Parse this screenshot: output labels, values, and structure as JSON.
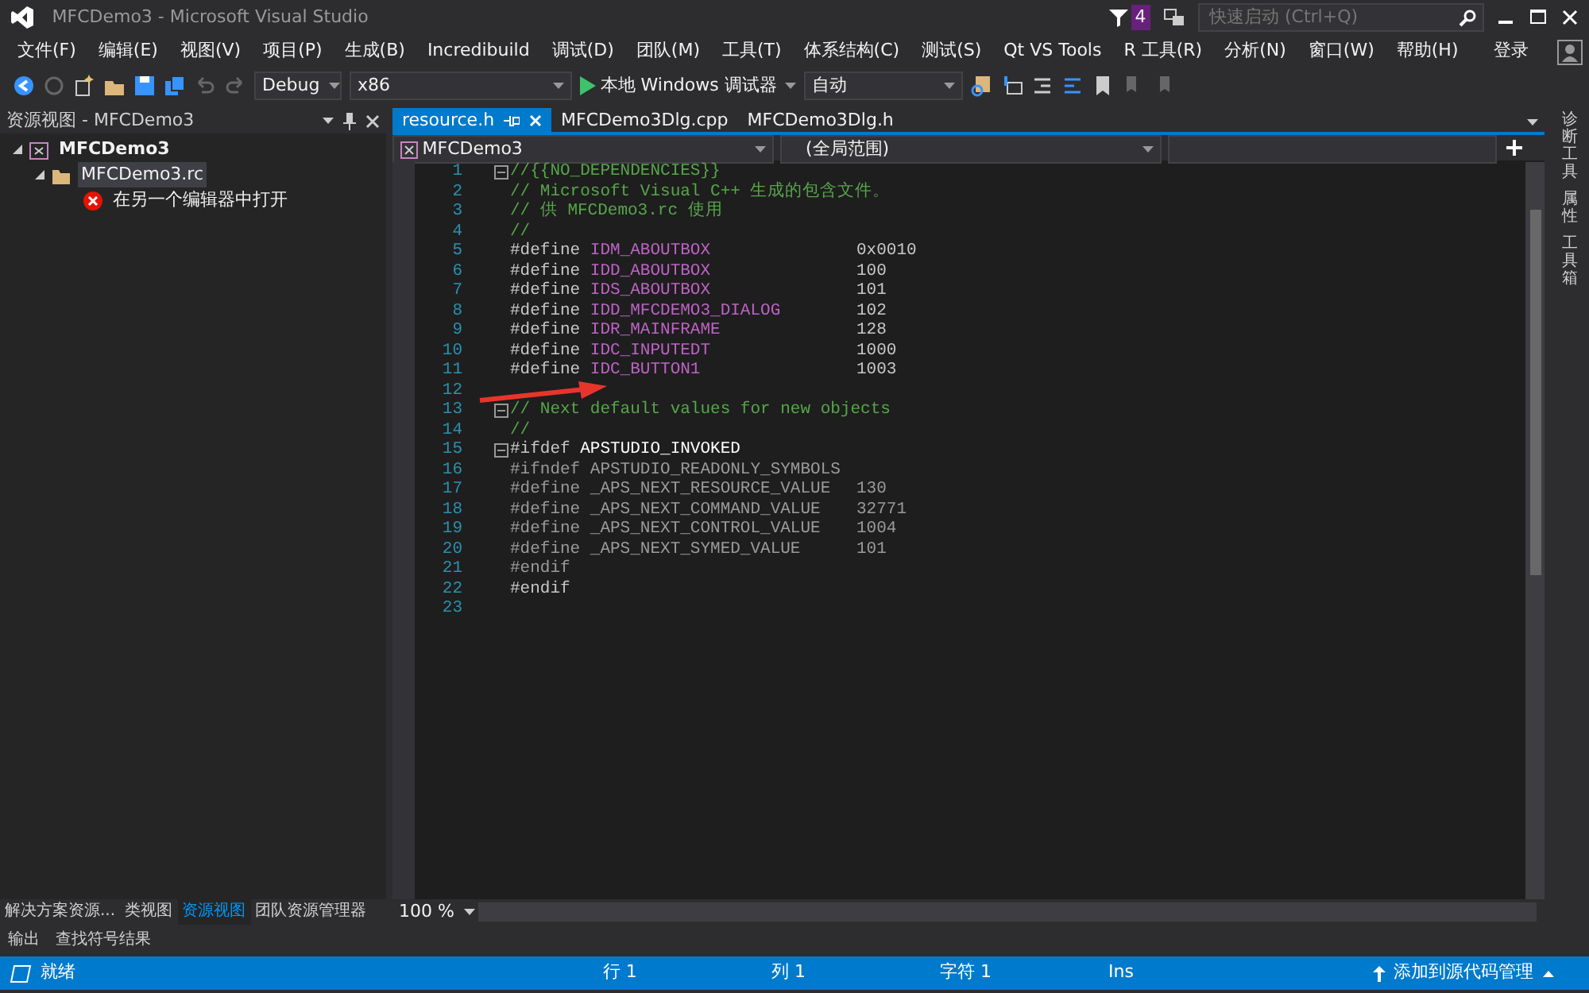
{
  "window": {
    "title": "MFCDemo3 - Microsoft Visual Studio",
    "notification_count": "4",
    "quick_launch": {
      "placeholder": "快速启动 (Ctrl+Q)"
    }
  },
  "menu": [
    "文件(F)",
    "编辑(E)",
    "视图(V)",
    "项目(P)",
    "生成(B)",
    "Incredibuild",
    "调试(D)",
    "团队(M)",
    "工具(T)",
    "体系结构(C)",
    "测试(S)",
    "Qt VS Tools",
    "R 工具(R)",
    "分析(N)",
    "窗口(W)",
    "帮助(H)"
  ],
  "sign_in": "登录",
  "toolbar": {
    "configuration": "Debug",
    "platform": "x86",
    "run": "本地 Windows 调试器",
    "run_target": "自动"
  },
  "resource_view": {
    "title": "资源视图 - MFCDemo3",
    "tree": [
      {
        "label": "MFCDemo3",
        "kind": "project",
        "expanded": true,
        "selected": false,
        "children": [
          {
            "label": "MFCDemo3.rc",
            "kind": "folder",
            "expanded": true,
            "selected": true,
            "children": [
              {
                "label": "在另一个编辑器中打开",
                "kind": "error",
                "selected": false
              }
            ]
          }
        ]
      }
    ],
    "tabs": [
      {
        "label": "解决方案资源...",
        "selected": false
      },
      {
        "label": "类视图",
        "selected": false
      },
      {
        "label": "资源视图",
        "selected": true
      },
      {
        "label": "团队资源管理器",
        "selected": false
      }
    ]
  },
  "editor": {
    "tabs": [
      {
        "label": "resource.h",
        "selected": true
      },
      {
        "label": "MFCDemo3Dlg.cpp",
        "selected": false
      },
      {
        "label": "MFCDemo3Dlg.h",
        "selected": false
      }
    ],
    "scope": "MFCDemo3",
    "member_scope": "(全局范围)",
    "zoom": "100 %",
    "lines": [
      {
        "number": "1",
        "fold": true,
        "tokens": [
          {
            "text": "//{{NO_DEPENDENCIES}}",
            "kind": "comment"
          }
        ]
      },
      {
        "number": "2",
        "fold": false,
        "tokens": [
          {
            "text": "// Microsoft Visual C++ 生成的包含文件。",
            "kind": "comment"
          }
        ]
      },
      {
        "number": "3",
        "fold": false,
        "tokens": [
          {
            "text": "// 供 MFCDemo3.rc 使用",
            "kind": "comment"
          }
        ]
      },
      {
        "number": "4",
        "fold": false,
        "tokens": [
          {
            "text": "//",
            "kind": "comment"
          }
        ]
      },
      {
        "number": "5",
        "fold": false,
        "tokens": [
          {
            "text": "#define",
            "kind": "plain"
          },
          {
            "text": "IDM_ABOUTBOX",
            "kind": "macro"
          }
        ],
        "value": {
          "text": "0x0010",
          "kind": "plain"
        }
      },
      {
        "number": "6",
        "fold": false,
        "tokens": [
          {
            "text": "#define",
            "kind": "plain"
          },
          {
            "text": "IDD_ABOUTBOX",
            "kind": "macro"
          }
        ],
        "value": {
          "text": "100",
          "kind": "plain"
        }
      },
      {
        "number": "7",
        "fold": false,
        "tokens": [
          {
            "text": "#define",
            "kind": "plain"
          },
          {
            "text": "IDS_ABOUTBOX",
            "kind": "macro"
          }
        ],
        "value": {
          "text": "101",
          "kind": "plain"
        }
      },
      {
        "number": "8",
        "fold": false,
        "tokens": [
          {
            "text": "#define",
            "kind": "plain"
          },
          {
            "text": "IDD_MFCDEMO3_DIALOG",
            "kind": "macro"
          }
        ],
        "value": {
          "text": "102",
          "kind": "plain"
        }
      },
      {
        "number": "9",
        "fold": false,
        "tokens": [
          {
            "text": "#define",
            "kind": "plain"
          },
          {
            "text": "IDR_MAINFRAME",
            "kind": "macro"
          }
        ],
        "value": {
          "text": "128",
          "kind": "plain"
        }
      },
      {
        "number": "10",
        "fold": false,
        "tokens": [
          {
            "text": "#define",
            "kind": "plain"
          },
          {
            "text": "IDC_INPUTEDT",
            "kind": "macro"
          }
        ],
        "value": {
          "text": "1000",
          "kind": "plain"
        }
      },
      {
        "number": "11",
        "fold": false,
        "tokens": [
          {
            "text": "#define",
            "kind": "plain"
          },
          {
            "text": "IDC_BUTTON1",
            "kind": "macro"
          }
        ],
        "value": {
          "text": "1003",
          "kind": "plain"
        }
      },
      {
        "number": "12",
        "fold": false
      },
      {
        "number": "13",
        "fold": true,
        "tokens": [
          {
            "text": "// Next default values for new objects",
            "kind": "comment"
          }
        ]
      },
      {
        "number": "14",
        "fold": false,
        "tokens": [
          {
            "text": "//",
            "kind": "comment"
          }
        ]
      },
      {
        "number": "15",
        "fold": true,
        "tokens": [
          {
            "text": "#ifdef",
            "kind": "plain"
          },
          {
            "text": "APSTUDIO_INVOKED",
            "kind": "strong"
          }
        ]
      },
      {
        "number": "16",
        "fold": false,
        "tokens": [
          {
            "text": "#ifndef",
            "kind": "inactive"
          },
          {
            "text": "APSTUDIO_READONLY_SYMBOLS",
            "kind": "inactive"
          }
        ]
      },
      {
        "number": "17",
        "fold": false,
        "tokens": [
          {
            "text": "#define",
            "kind": "inactive"
          },
          {
            "text": "_APS_NEXT_RESOURCE_VALUE",
            "kind": "inactive"
          }
        ],
        "value": {
          "text": "130",
          "kind": "inactive"
        }
      },
      {
        "number": "18",
        "fold": false,
        "tokens": [
          {
            "text": "#define",
            "kind": "inactive"
          },
          {
            "text": "_APS_NEXT_COMMAND_VALUE",
            "kind": "inactive"
          }
        ],
        "value": {
          "text": "32771",
          "kind": "inactive"
        }
      },
      {
        "number": "19",
        "fold": false,
        "tokens": [
          {
            "text": "#define",
            "kind": "inactive"
          },
          {
            "text": "_APS_NEXT_CONTROL_VALUE",
            "kind": "inactive"
          }
        ],
        "value": {
          "text": "1004",
          "kind": "inactive"
        }
      },
      {
        "number": "20",
        "fold": false,
        "tokens": [
          {
            "text": "#define",
            "kind": "inactive"
          },
          {
            "text": "_APS_NEXT_SYMED_VALUE",
            "kind": "inactive"
          }
        ],
        "value": {
          "text": "101",
          "kind": "inactive"
        }
      },
      {
        "number": "21",
        "fold": false,
        "tokens": [
          {
            "text": "#endif",
            "kind": "inactive"
          }
        ]
      },
      {
        "number": "22",
        "fold": false,
        "tokens": [
          {
            "text": "#endif",
            "kind": "plain"
          }
        ]
      },
      {
        "number": "23",
        "fold": false
      }
    ]
  },
  "side_tabs": [
    "诊断工具",
    "属性",
    "工具箱"
  ],
  "output_tabs": [
    "输出",
    "查找符号结果"
  ],
  "status_bar": {
    "state": "就绪",
    "line": "行 1",
    "column": "列 1",
    "char": "字符 1",
    "mode": "Ins",
    "source_control": "添加到源代码管理"
  }
}
